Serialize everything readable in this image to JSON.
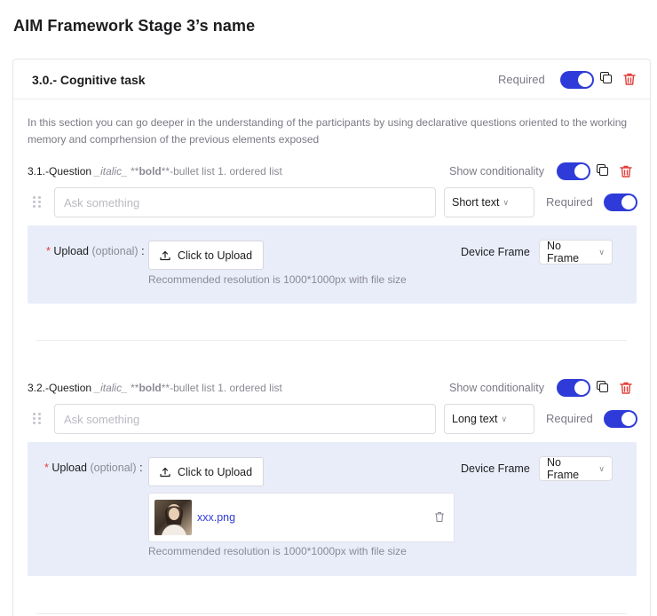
{
  "page": {
    "title": "AIM Framework Stage 3’s name"
  },
  "section": {
    "title": "3.0.- Cognitive task",
    "required_label": "Required",
    "description": "In this section you can go deeper in the understanding of the participants by using declarative questions oriented to the working memory and comprhension of the previous elements exposed"
  },
  "questions": [
    {
      "prefix": "3.1.-Question",
      "format_italic": "_italic_",
      "format_bold_open": "**",
      "format_bold": "bold",
      "format_bold_close": "**",
      "format_rest": "-bullet list 1. ordered list",
      "show_conditionality": "Show conditionality",
      "input_placeholder": "Ask something",
      "type": "Short text",
      "required_label": "Required",
      "upload": {
        "star": "*",
        "label": "Upload",
        "optional": "(optional)",
        "colon": ":",
        "button": "Click to Upload",
        "hint": "Recommended resolution is 1000*1000px with file size"
      },
      "device_frame_label": "Device Frame",
      "device_frame_value": "No Frame"
    },
    {
      "prefix": "3.2.-Question",
      "format_italic": "_italic_",
      "format_bold_open": "**",
      "format_bold": "bold",
      "format_bold_close": "**",
      "format_rest": "-bullet list 1. ordered list",
      "show_conditionality": "Show conditionality",
      "input_placeholder": "Ask something",
      "type": "Long text",
      "required_label": "Required",
      "upload": {
        "star": "*",
        "label": "Upload",
        "optional": "(optional)",
        "colon": ":",
        "button": "Click to Upload",
        "hint": "Recommended resolution is 1000*1000px with file size",
        "file_name": "xxx.png"
      },
      "device_frame_label": "Device Frame",
      "device_frame_value": "No Frame"
    }
  ],
  "colors": {
    "accent": "#2f3bd8",
    "danger": "#e2403a",
    "panel": "#e9edfa"
  },
  "icons": [
    "copy-icon",
    "trash-icon",
    "drag-handle-icon",
    "upload-icon",
    "chevron-down-icon",
    "image-thumbnail"
  ]
}
